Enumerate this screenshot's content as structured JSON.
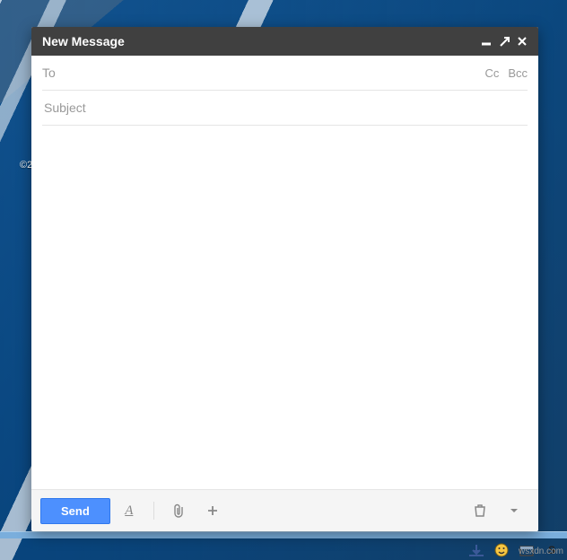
{
  "footer_copyright": "©2",
  "compose": {
    "title": "New Message",
    "to_label": "To",
    "cc_label": "Cc",
    "bcc_label": "Bcc",
    "subject_placeholder": "Subject",
    "to_value": "",
    "subject_value": "",
    "body_value": "",
    "send_label": "Send"
  },
  "watermark": "wsxdn.com"
}
